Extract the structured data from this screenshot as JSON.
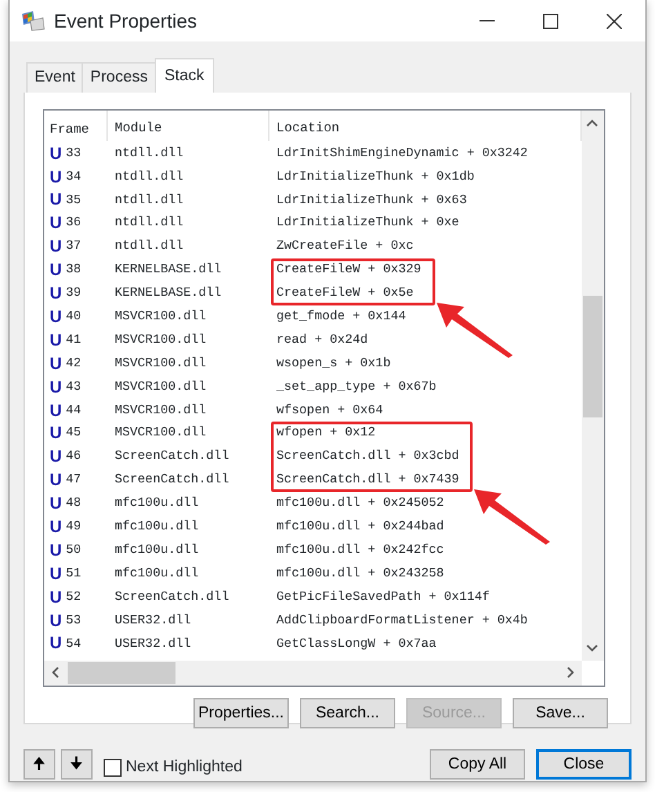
{
  "window": {
    "title": "Event Properties"
  },
  "tabs": [
    {
      "label": "Event",
      "selected": false
    },
    {
      "label": "Process",
      "selected": false
    },
    {
      "label": "Stack",
      "selected": true
    }
  ],
  "table": {
    "columns": [
      "Frame",
      "Module",
      "Location"
    ],
    "rows": [
      {
        "mode": "U",
        "frame": "33",
        "module": "ntdll.dll",
        "location": "LdrInitShimEngineDynamic + 0x3242",
        "annotated": false
      },
      {
        "mode": "U",
        "frame": "34",
        "module": "ntdll.dll",
        "location": "LdrInitializeThunk + 0x1db",
        "annotated": false
      },
      {
        "mode": "U",
        "frame": "35",
        "module": "ntdll.dll",
        "location": "LdrInitializeThunk + 0x63",
        "annotated": false
      },
      {
        "mode": "U",
        "frame": "36",
        "module": "ntdll.dll",
        "location": "LdrInitializeThunk + 0xe",
        "annotated": false
      },
      {
        "mode": "U",
        "frame": "37",
        "module": "ntdll.dll",
        "location": "ZwCreateFile + 0xc",
        "annotated": false
      },
      {
        "mode": "U",
        "frame": "38",
        "module": "KERNELBASE.dll",
        "location": "CreateFileW + 0x329",
        "annotated": true
      },
      {
        "mode": "U",
        "frame": "39",
        "module": "KERNELBASE.dll",
        "location": "CreateFileW + 0x5e",
        "annotated": true
      },
      {
        "mode": "U",
        "frame": "40",
        "module": "MSVCR100.dll",
        "location": "get_fmode + 0x144",
        "annotated": false
      },
      {
        "mode": "U",
        "frame": "41",
        "module": "MSVCR100.dll",
        "location": "read + 0x24d",
        "annotated": false
      },
      {
        "mode": "U",
        "frame": "42",
        "module": "MSVCR100.dll",
        "location": "wsopen_s + 0x1b",
        "annotated": false
      },
      {
        "mode": "U",
        "frame": "43",
        "module": "MSVCR100.dll",
        "location": "_set_app_type + 0x67b",
        "annotated": false
      },
      {
        "mode": "U",
        "frame": "44",
        "module": "MSVCR100.dll",
        "location": "wfsopen + 0x64",
        "annotated": false
      },
      {
        "mode": "U",
        "frame": "45",
        "module": "MSVCR100.dll",
        "location": "wfopen + 0x12",
        "annotated": true
      },
      {
        "mode": "U",
        "frame": "46",
        "module": "ScreenCatch.dll",
        "location": "ScreenCatch.dll + 0x3cbd",
        "annotated": true
      },
      {
        "mode": "U",
        "frame": "47",
        "module": "ScreenCatch.dll",
        "location": "ScreenCatch.dll + 0x7439",
        "annotated": true
      },
      {
        "mode": "U",
        "frame": "48",
        "module": "mfc100u.dll",
        "location": "mfc100u.dll + 0x245052",
        "annotated": false
      },
      {
        "mode": "U",
        "frame": "49",
        "module": "mfc100u.dll",
        "location": "mfc100u.dll + 0x244bad",
        "annotated": false
      },
      {
        "mode": "U",
        "frame": "50",
        "module": "mfc100u.dll",
        "location": "mfc100u.dll + 0x242fcc",
        "annotated": false
      },
      {
        "mode": "U",
        "frame": "51",
        "module": "mfc100u.dll",
        "location": "mfc100u.dll + 0x243258",
        "annotated": false
      },
      {
        "mode": "U",
        "frame": "52",
        "module": "ScreenCatch.dll",
        "location": "GetPicFileSavedPath + 0x114f",
        "annotated": false
      },
      {
        "mode": "U",
        "frame": "53",
        "module": "USER32.dll",
        "location": "AddClipboardFormatListener + 0x4b",
        "annotated": false
      },
      {
        "mode": "U",
        "frame": "54",
        "module": "USER32.dll",
        "location": "GetClassLongW + 0x7aa",
        "annotated": false
      }
    ]
  },
  "panel_buttons": [
    {
      "label": "Properties...",
      "disabled": false
    },
    {
      "label": "Search...",
      "disabled": false
    },
    {
      "label": "Source...",
      "disabled": true
    },
    {
      "label": "Save...",
      "disabled": false
    }
  ],
  "footer": {
    "up_button": "🠉",
    "down_button": "🠋",
    "next_highlighted": {
      "label": "Next Highlighted",
      "checked": false
    },
    "buttons": [
      {
        "label": "Copy All",
        "default": false
      },
      {
        "label": "Close",
        "default": true
      }
    ]
  }
}
